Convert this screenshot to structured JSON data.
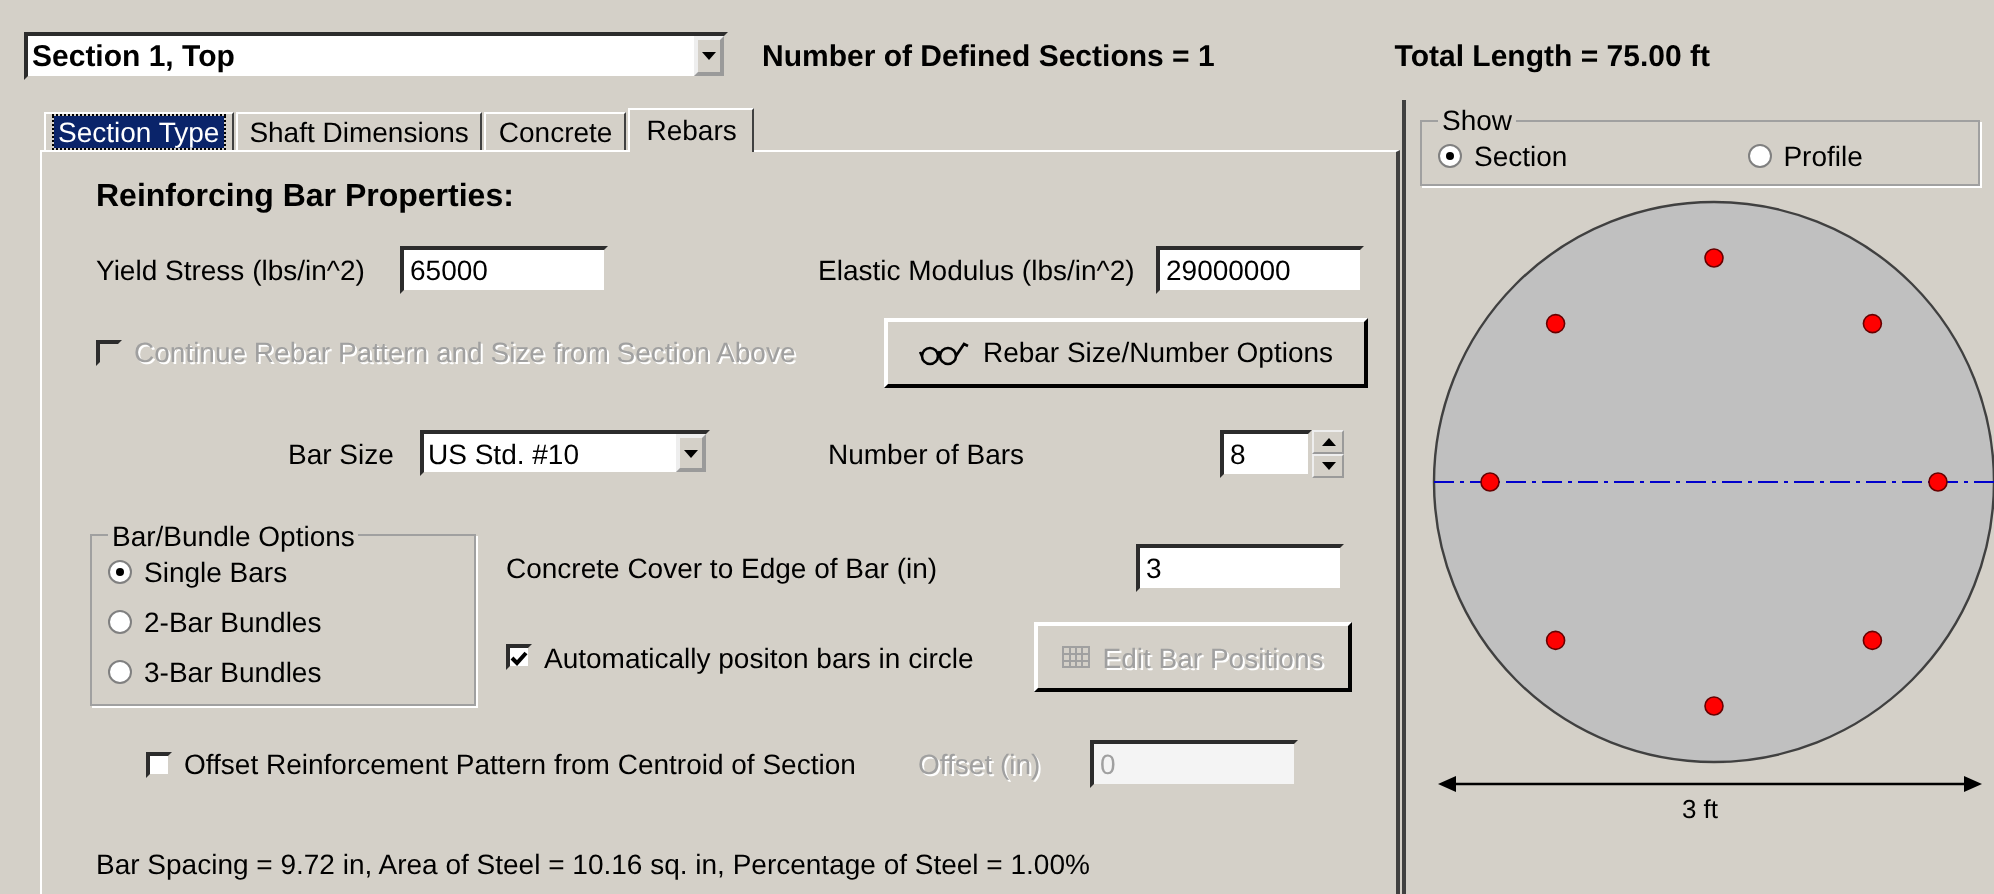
{
  "section_select": {
    "value": "Section 1, Top"
  },
  "defined_sections": "Number of Defined Sections = 1",
  "total_length": "Total Length = 75.00 ft",
  "tabs": [
    {
      "label": "Section Type",
      "selected": false,
      "highlighted": true
    },
    {
      "label": "Shaft Dimensions",
      "selected": false,
      "highlighted": false
    },
    {
      "label": "Concrete",
      "selected": false,
      "highlighted": false
    },
    {
      "label": "Rebars",
      "selected": true,
      "highlighted": false
    }
  ],
  "heading": "Reinforcing Bar Properties:",
  "yield_stress": {
    "label": "Yield Stress (lbs/in^2)",
    "value": "65000"
  },
  "elastic_modulus": {
    "label": "Elastic Modulus (lbs/in^2)",
    "value": "29000000"
  },
  "continue_pattern": {
    "label": "Continue Rebar Pattern and Size from Section Above",
    "checked": false,
    "disabled": true
  },
  "options_button": {
    "label": "Rebar Size/Number Options",
    "disabled": false
  },
  "bar_size": {
    "label": "Bar Size",
    "value": "US Std. #10"
  },
  "number_of_bars": {
    "label": "Number of Bars",
    "value": "8"
  },
  "bundle_options": {
    "title": "Bar/Bundle Options",
    "items": [
      {
        "label": "Single Bars",
        "selected": true
      },
      {
        "label": "2-Bar Bundles",
        "selected": false
      },
      {
        "label": "3-Bar Bundles",
        "selected": false
      }
    ]
  },
  "concrete_cover": {
    "label": "Concrete Cover to Edge of Bar (in)",
    "value": "3"
  },
  "auto_position": {
    "label": "Automatically positon bars in circle",
    "checked": true,
    "disabled": false
  },
  "edit_positions_button": {
    "label": "Edit Bar Positions",
    "disabled": true
  },
  "offset_pattern": {
    "label": "Offset Reinforcement Pattern from Centroid of Section",
    "checked": false,
    "disabled": false
  },
  "offset": {
    "label": "Offset (in)",
    "value": "0",
    "disabled": true
  },
  "summary": "Bar Spacing = 9.72 in, Area of Steel = 10.16 sq. in, Percentage of Steel = 1.00%",
  "show": {
    "title": "Show",
    "items": [
      {
        "label": "Section",
        "selected": true
      },
      {
        "label": "Profile",
        "selected": false
      }
    ]
  },
  "dimension_label": "3 ft"
}
